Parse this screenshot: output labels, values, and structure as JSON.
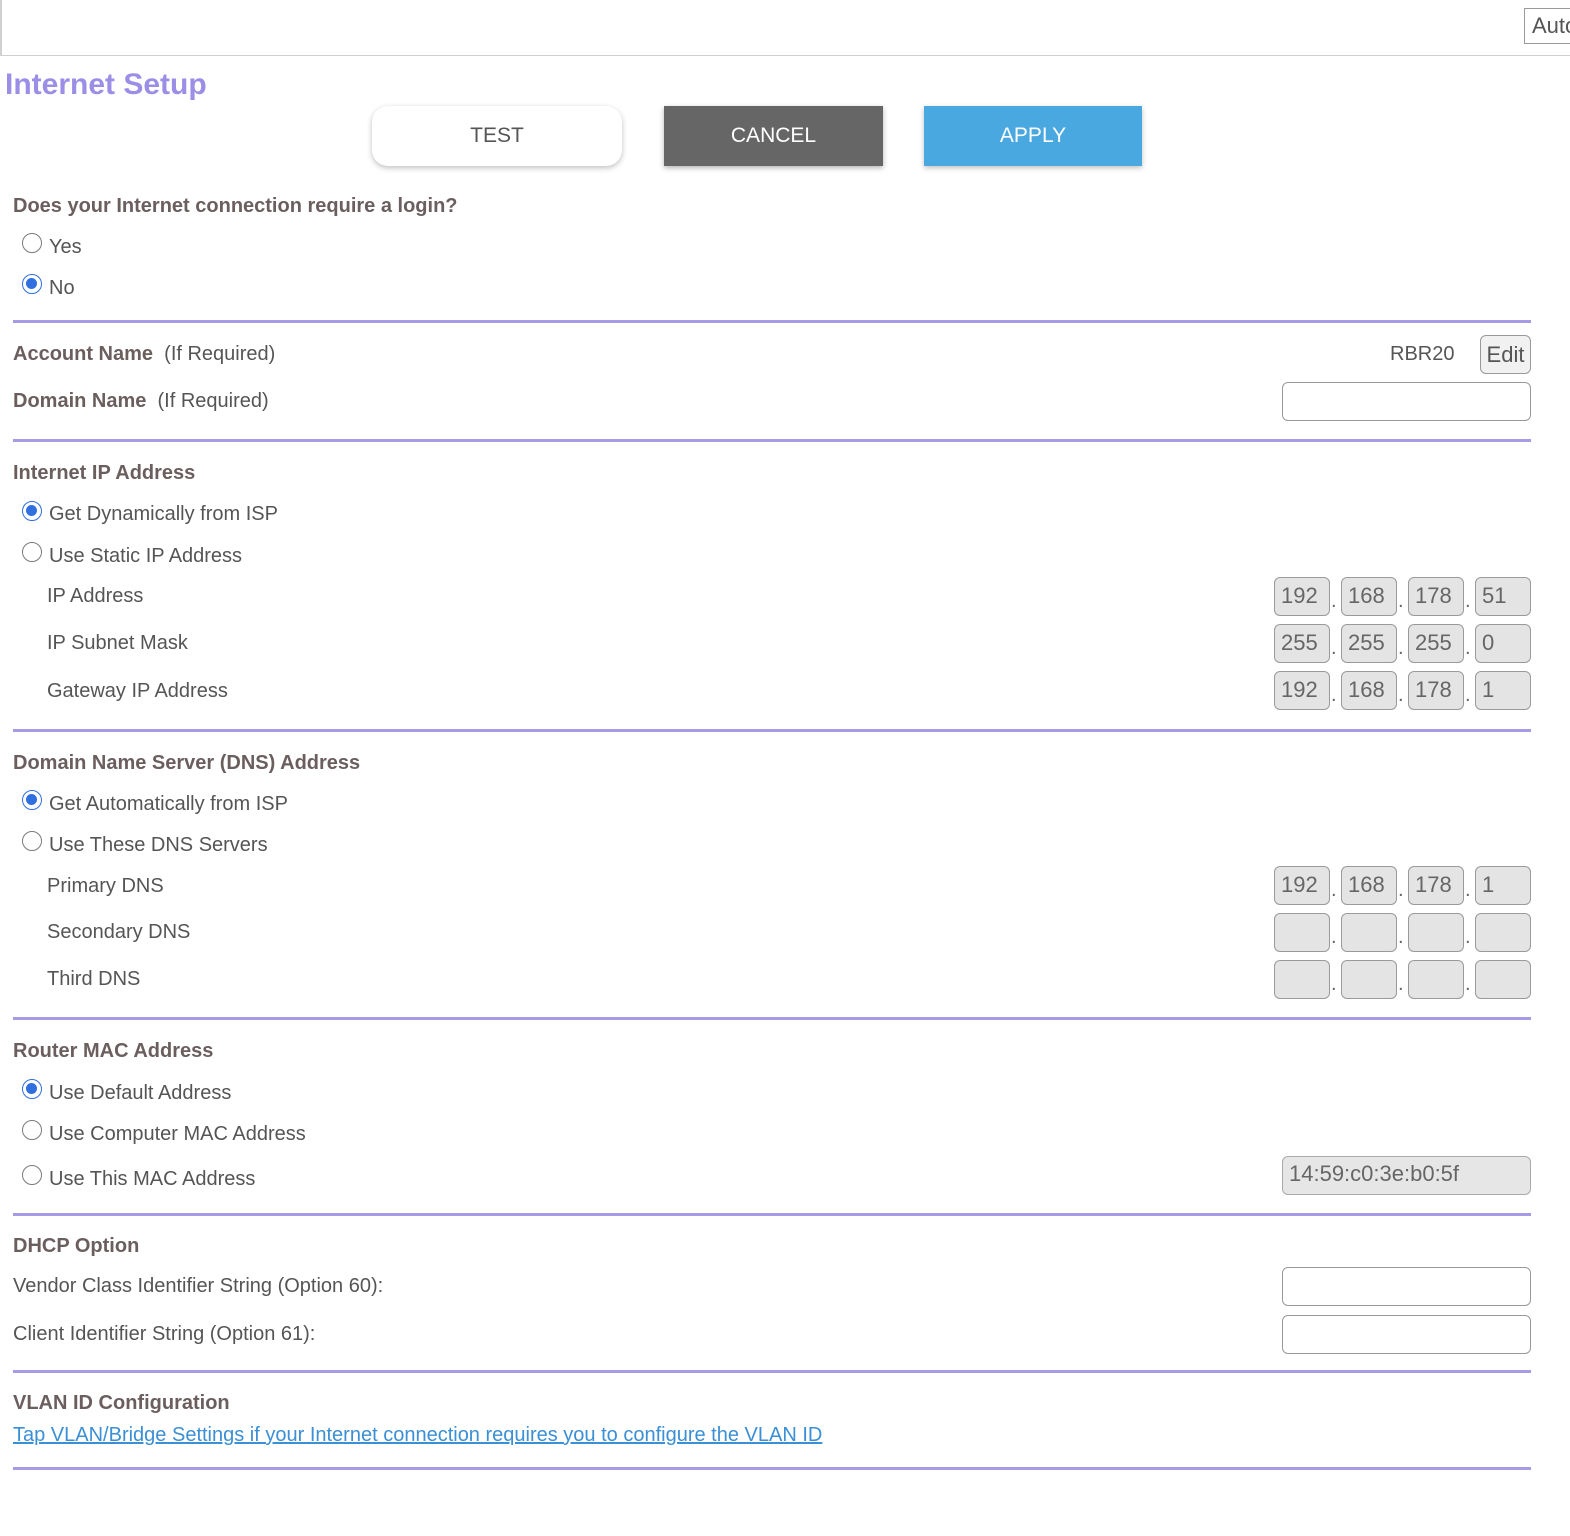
{
  "topbar": {
    "select_value": "Auto"
  },
  "page": {
    "title": "Internet Setup"
  },
  "buttons": {
    "test": "TEST",
    "cancel": "CANCEL",
    "apply": "APPLY"
  },
  "login": {
    "question": "Does your Internet connection require a login?",
    "options": [
      {
        "label": "Yes",
        "checked": false
      },
      {
        "label": "No",
        "checked": true
      }
    ]
  },
  "account": {
    "account_name_label": "Account Name",
    "account_name_hint": "(If Required)",
    "account_name_value": "RBR20",
    "edit_label": "Edit",
    "domain_name_label": "Domain Name",
    "domain_name_hint": "(If Required)",
    "domain_name_value": ""
  },
  "internet_ip": {
    "heading": "Internet IP Address",
    "options": [
      {
        "label": "Get Dynamically from ISP",
        "checked": true
      },
      {
        "label": "Use Static IP Address",
        "checked": false
      }
    ],
    "fields": [
      {
        "label": "IP Address",
        "octets": [
          "192",
          "168",
          "178",
          "51"
        ]
      },
      {
        "label": "IP Subnet Mask",
        "octets": [
          "255",
          "255",
          "255",
          "0"
        ]
      },
      {
        "label": "Gateway IP Address",
        "octets": [
          "192",
          "168",
          "178",
          "1"
        ]
      }
    ]
  },
  "dns": {
    "heading": "Domain Name Server (DNS) Address",
    "options": [
      {
        "label": "Get Automatically from ISP",
        "checked": true
      },
      {
        "label": "Use These DNS Servers",
        "checked": false
      }
    ],
    "fields": [
      {
        "label": "Primary DNS",
        "octets": [
          "192",
          "168",
          "178",
          "1"
        ]
      },
      {
        "label": "Secondary DNS",
        "octets": [
          "",
          "",
          "",
          ""
        ]
      },
      {
        "label": "Third DNS",
        "octets": [
          "",
          "",
          "",
          ""
        ]
      }
    ]
  },
  "mac": {
    "heading": "Router MAC Address",
    "options": [
      {
        "label": "Use Default Address",
        "checked": true
      },
      {
        "label": "Use Computer MAC Address",
        "checked": false
      },
      {
        "label": "Use This MAC Address",
        "checked": false
      }
    ],
    "mac_value": "14:59:c0:3e:b0:5f"
  },
  "dhcp": {
    "heading": "DHCP Option",
    "vendor_label": "Vendor Class Identifier String (Option 60):",
    "vendor_value": "",
    "client_label": "Client Identifier String (Option 61):",
    "client_value": ""
  },
  "vlan": {
    "heading": "VLAN ID Configuration",
    "link": "Tap VLAN/Bridge Settings if your Internet connection requires you to configure the VLAN ID"
  },
  "colors": {
    "title": "#9b8ee6",
    "divider": "#a89be6",
    "cancel_bg": "#666666",
    "apply_bg": "#4aa8e0",
    "radio_checked": "#2f6fe0",
    "link": "#3a8fd6"
  }
}
